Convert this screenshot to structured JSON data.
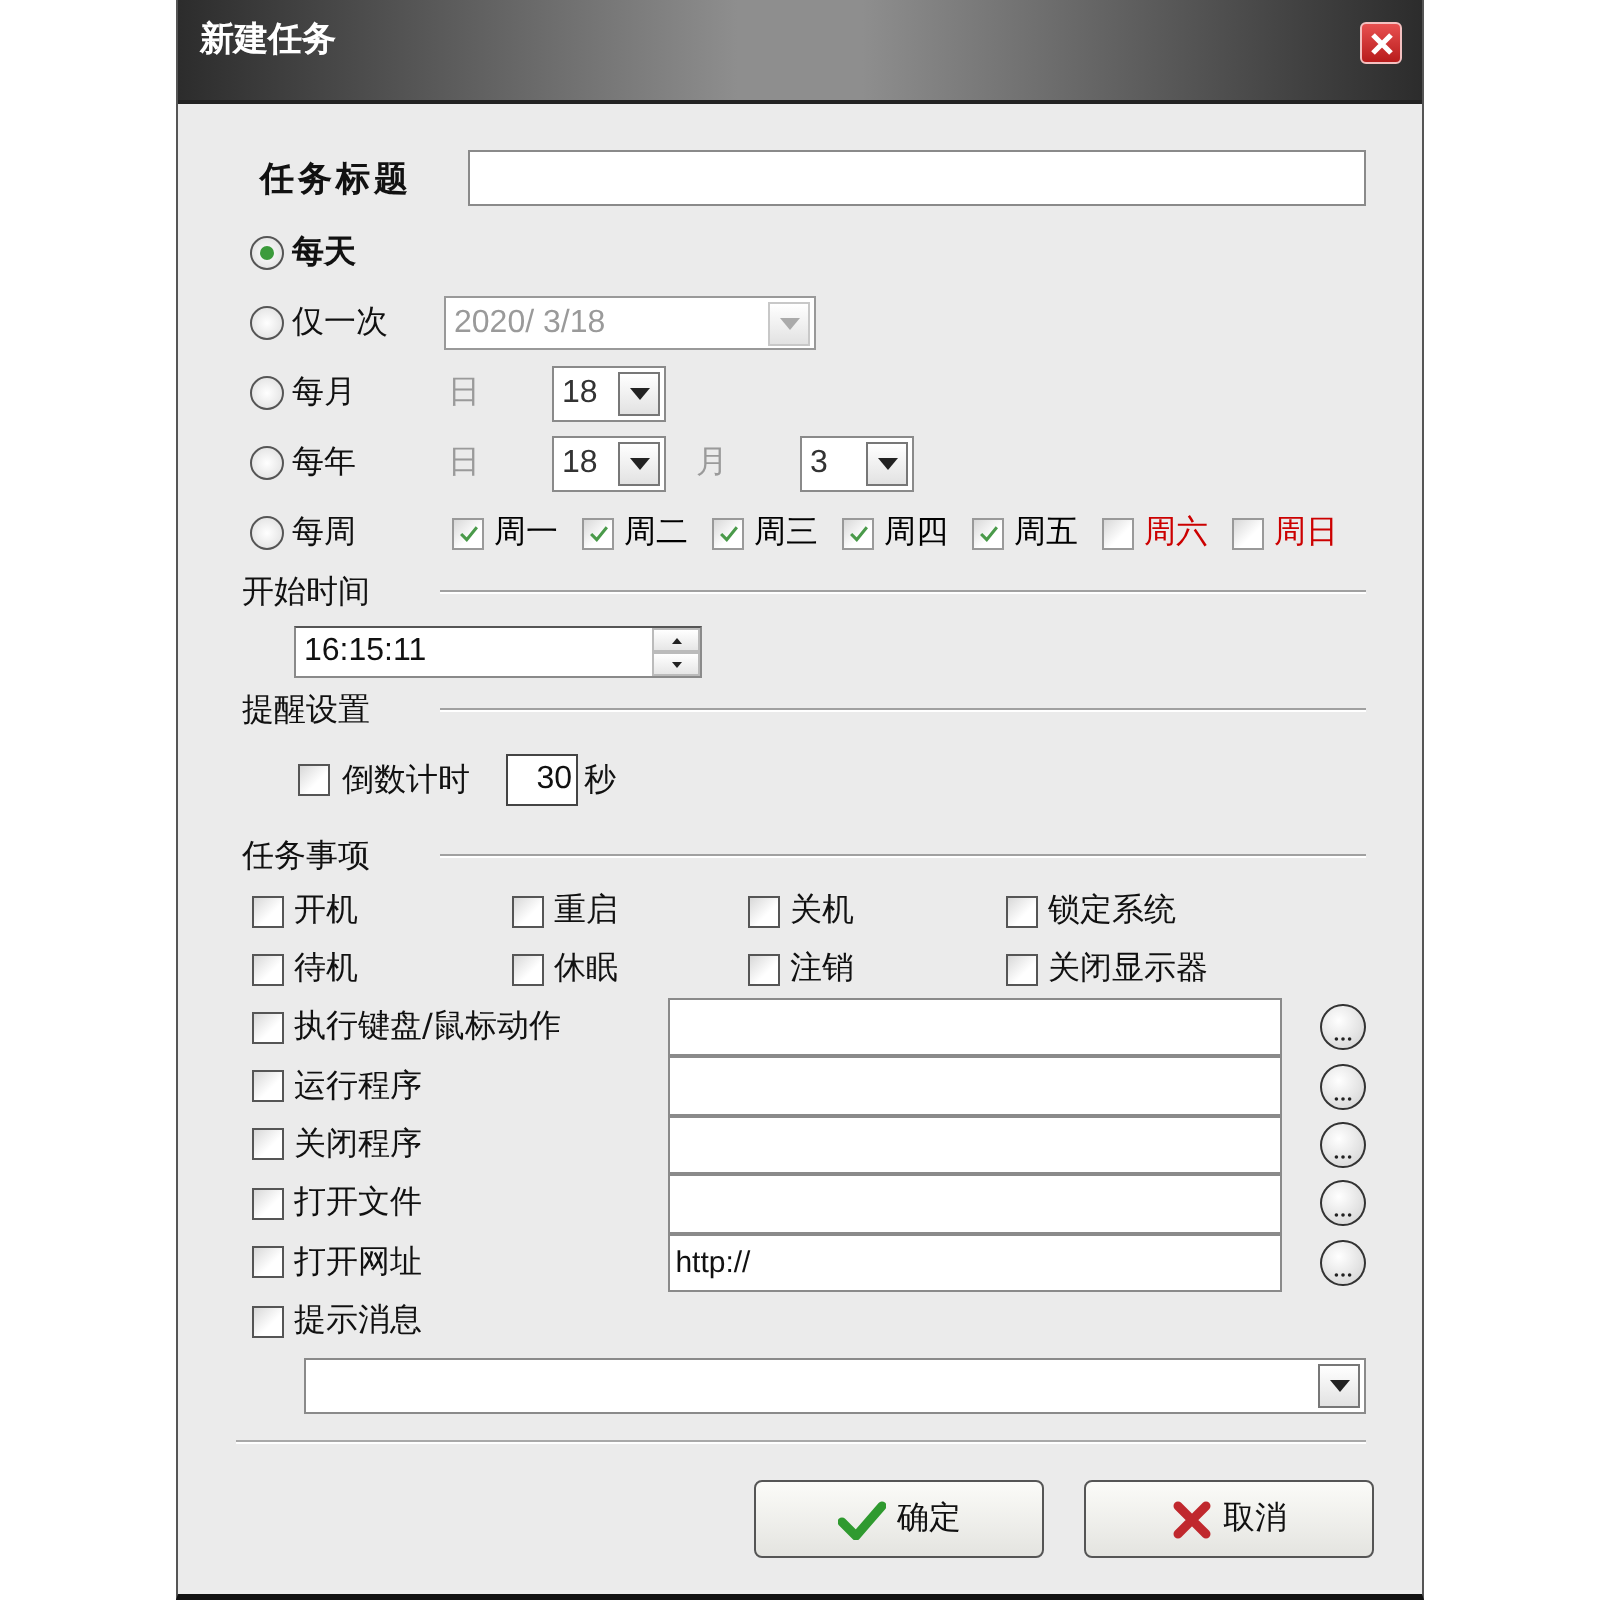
{
  "window": {
    "title": "新建任务"
  },
  "task_title": {
    "label": "任务标题"
  },
  "schedule": [
    {
      "kind": "plain",
      "label": "每天",
      "selected": true
    },
    {
      "kind": "date",
      "label": "仅一次",
      "selected": false,
      "date": {
        "value": "2020/ 3/18",
        "disabled": true
      }
    },
    {
      "kind": "fields",
      "label": "每月",
      "selected": false,
      "fields": [
        {
          "label": "日",
          "value": "18"
        }
      ]
    },
    {
      "kind": "fields",
      "label": "每年",
      "selected": false,
      "fields": [
        {
          "label": "日",
          "value": "18"
        },
        {
          "label": "月",
          "value": "3"
        }
      ]
    },
    {
      "kind": "weekdays",
      "label": "每周",
      "selected": false,
      "days": [
        {
          "label": "周一",
          "checked": true,
          "color": "#000000"
        },
        {
          "label": "周二",
          "checked": true,
          "color": "#000000"
        },
        {
          "label": "周三",
          "checked": true,
          "color": "#000000"
        },
        {
          "label": "周四",
          "checked": true,
          "color": "#000000"
        },
        {
          "label": "周五",
          "checked": true,
          "color": "#000000"
        },
        {
          "label": "周六",
          "checked": false,
          "color": "#cc0000"
        },
        {
          "label": "周日",
          "checked": false,
          "color": "#cc0000"
        }
      ]
    }
  ],
  "start_time": {
    "label": "开始时间",
    "value": "16:15:11"
  },
  "reminder": {
    "label": "提醒设置",
    "countdown": {
      "label": "倒数计时",
      "checked": false,
      "value": "30",
      "unit": "秒"
    }
  },
  "task_items": {
    "label": "任务事项",
    "options": [
      {
        "label": "开机",
        "checked": false
      },
      {
        "label": "重启",
        "checked": false
      },
      {
        "label": "关机",
        "checked": false
      },
      {
        "label": "锁定系统",
        "checked": false
      },
      {
        "label": "待机",
        "checked": false
      },
      {
        "label": "休眠",
        "checked": false
      },
      {
        "label": "注销",
        "checked": false
      },
      {
        "label": "关闭显示器",
        "checked": false
      }
    ],
    "actions": [
      {
        "label": "执行键盘/鼠标动作",
        "checked": false
      },
      {
        "label": "运行程序",
        "checked": false
      },
      {
        "label": "关闭程序",
        "checked": false
      },
      {
        "label": "打开文件",
        "checked": false
      },
      {
        "label": "打开网址",
        "checked": false,
        "value": "http://"
      }
    ],
    "message": {
      "label": "提示消息",
      "checked": false
    }
  },
  "buttons": [
    {
      "kind": "ok",
      "label": "确定"
    },
    {
      "kind": "cancel",
      "label": "取消"
    }
  ]
}
